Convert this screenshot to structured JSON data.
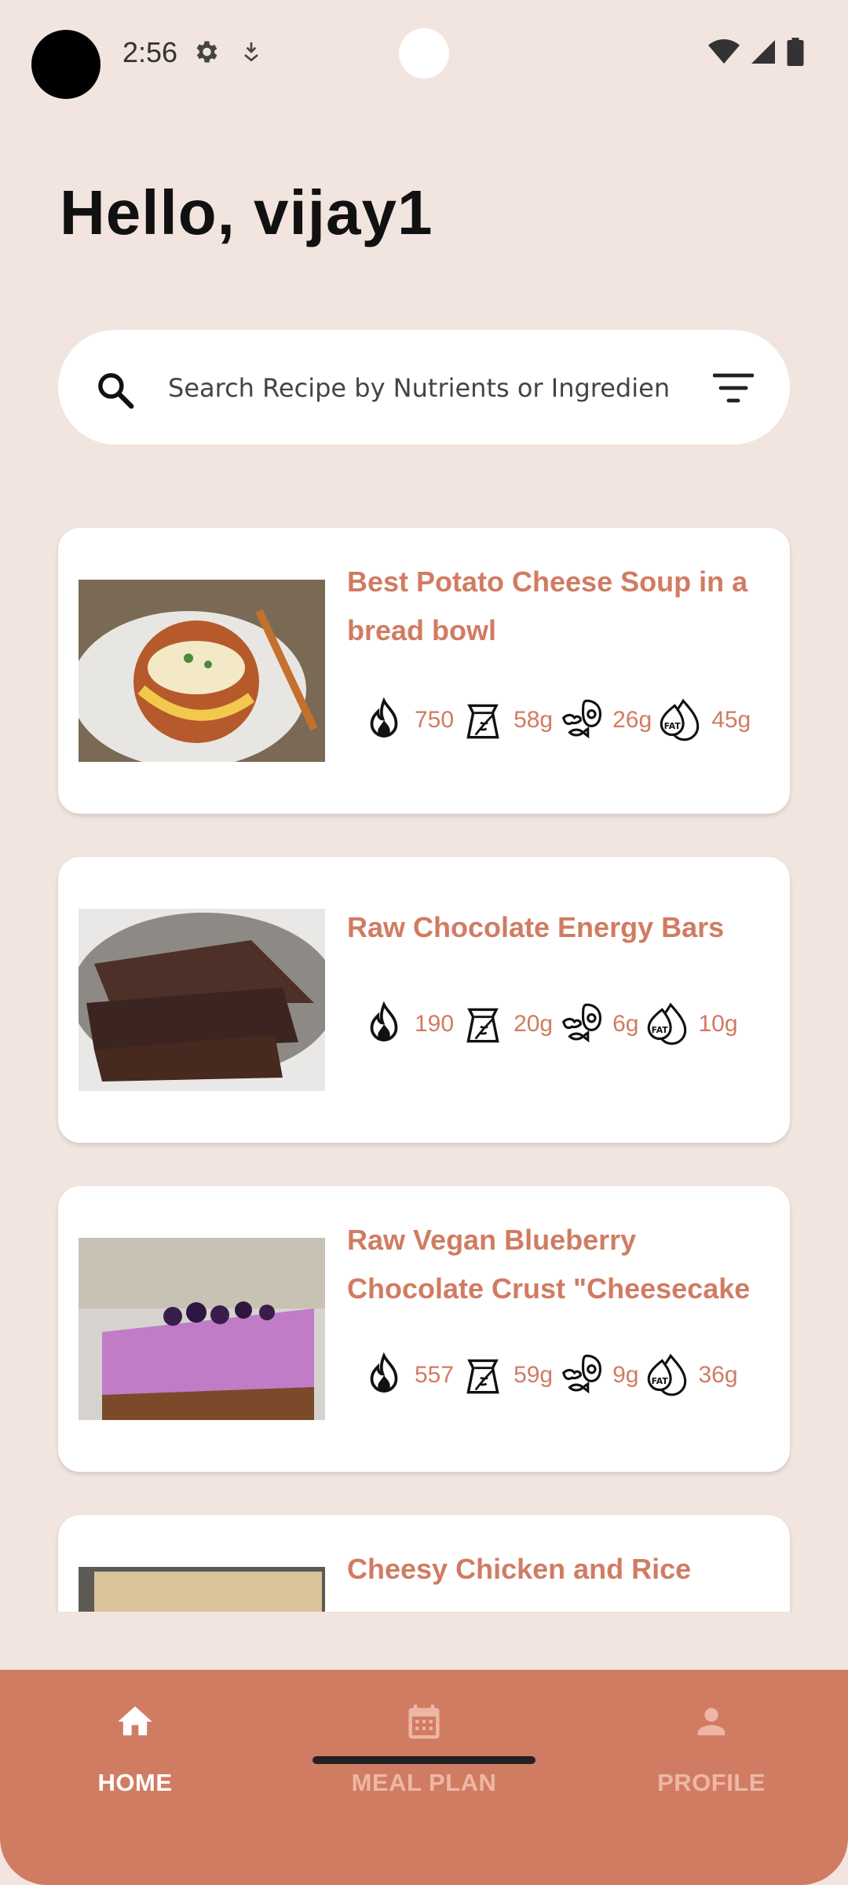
{
  "status_bar": {
    "time": "2:56",
    "icons": [
      "settings-icon",
      "download-icon",
      "wifi-icon",
      "cellular-icon",
      "battery-icon"
    ]
  },
  "greeting": "Hello, vijay1",
  "search": {
    "placeholder": "Search Recipe by Nutrients or Ingredients",
    "value": ""
  },
  "recipes": [
    {
      "title": "Best Potato Cheese Soup in a bread bowl",
      "calories": "750",
      "carbs": "58g",
      "protein": "26g",
      "fat": "45g"
    },
    {
      "title": "Raw Chocolate Energy Bars",
      "calories": "190",
      "carbs": "20g",
      "protein": "6g",
      "fat": "10g"
    },
    {
      "title": "Raw Vegan Blueberry Chocolate Crust \"Cheesecake",
      "calories": "557",
      "carbs": "59g",
      "protein": "9g",
      "fat": "36g"
    },
    {
      "title": "Cheesy Chicken and Rice"
    }
  ],
  "nutrient_icons": {
    "calories": "flame-icon",
    "carbs": "grain-sack-icon",
    "protein": "meat-icon",
    "fat": "fat-drop-icon",
    "fat_label": "FAT"
  },
  "bottom_nav": {
    "items": [
      {
        "label": "HOME",
        "icon": "home-icon",
        "active": true
      },
      {
        "label": "MEAL PLAN",
        "icon": "calendar-icon",
        "active": false
      },
      {
        "label": "PROFILE",
        "icon": "person-icon",
        "active": false
      }
    ]
  },
  "colors": {
    "background": "#f2e4de",
    "accent": "#d07c62",
    "card": "#ffffff",
    "nav_active": "#ffffff",
    "nav_inactive": "#eeb7a5"
  }
}
